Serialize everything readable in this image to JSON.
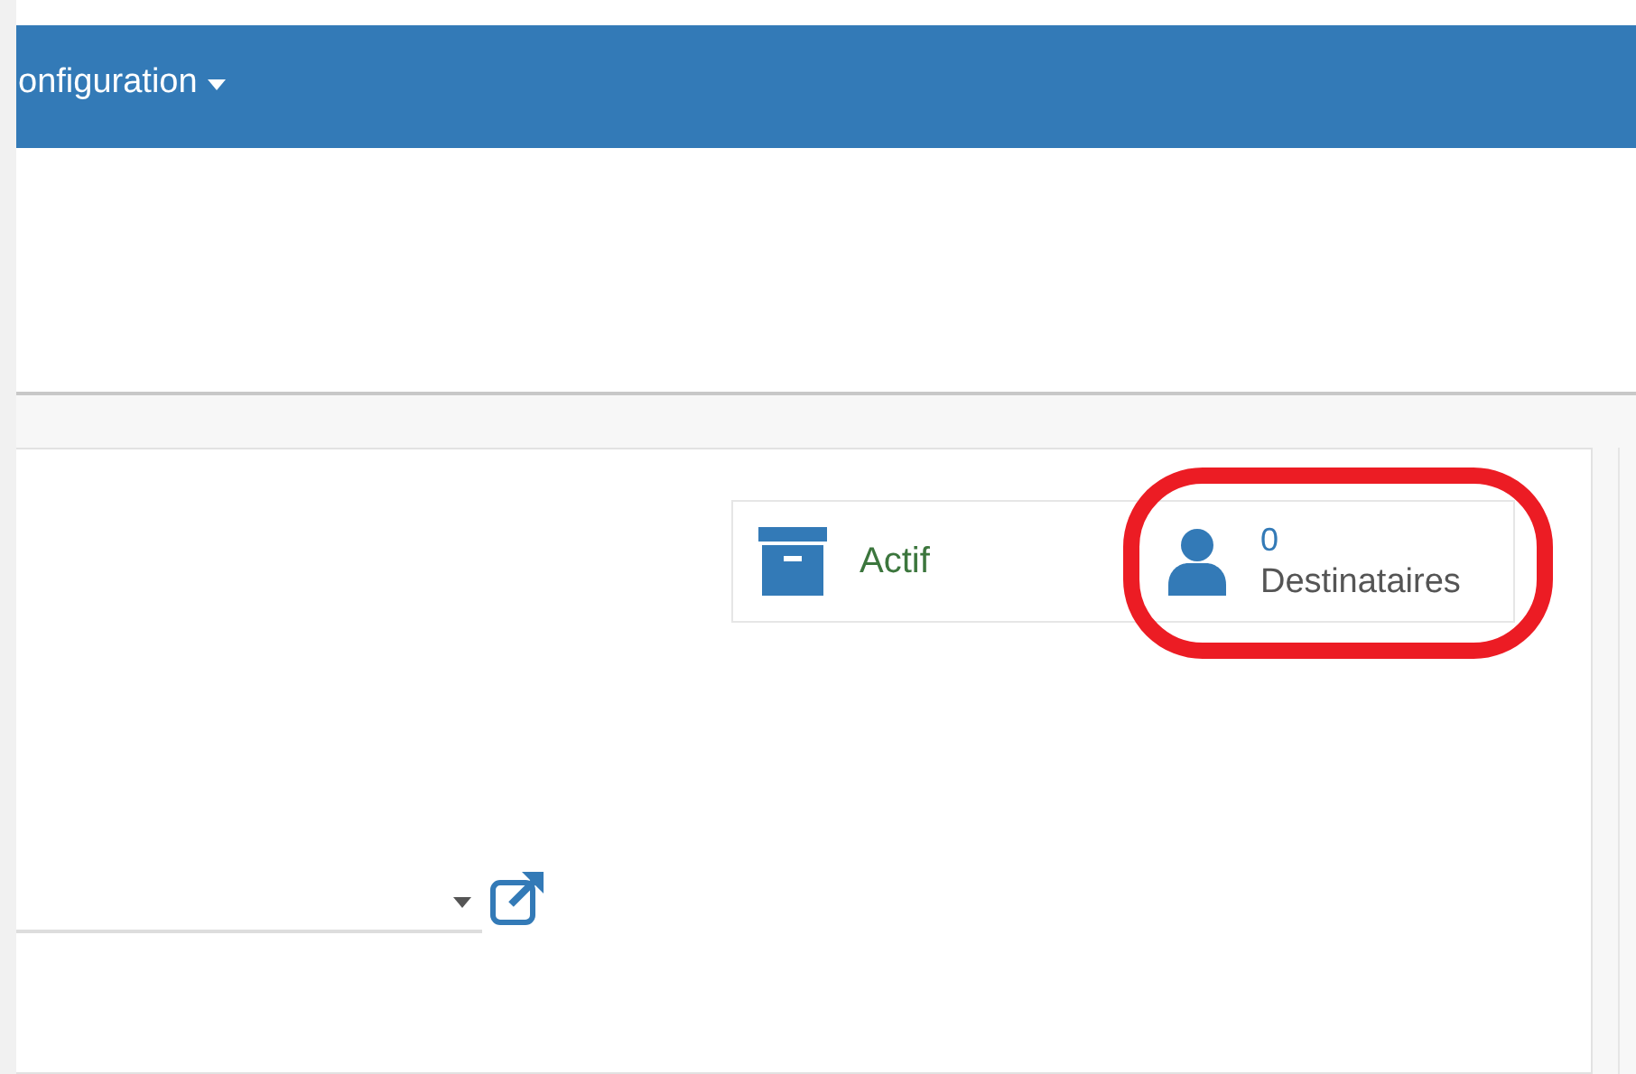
{
  "navbar": {
    "menu": {
      "label": "onfiguration"
    }
  },
  "stats": [
    {
      "kind": "status",
      "label": "Actif"
    },
    {
      "kind": "recipients",
      "count": "0",
      "label": "Destinataires",
      "highlighted": true
    }
  ]
}
